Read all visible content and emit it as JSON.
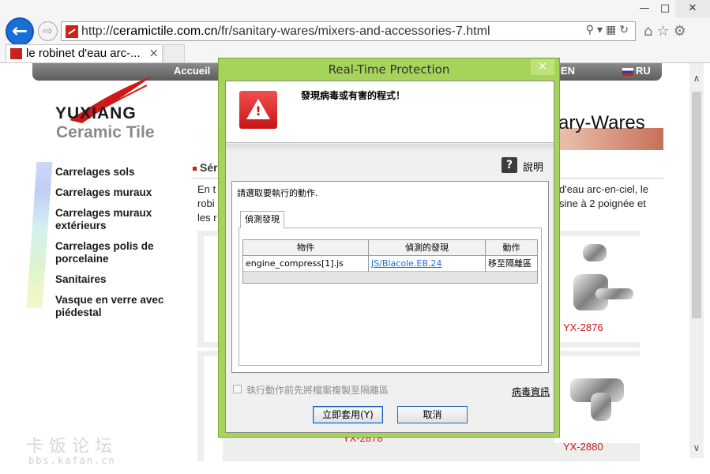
{
  "browser": {
    "address_url_prefix": "http://",
    "address_url_domain": "ceramictile.com.cn",
    "address_url_path": "/fr/sanitary-wares/mixers-and-accessories-7.html",
    "tab_title": "le robinet d'eau arc-...",
    "back_icon": "back-arrow-icon",
    "forward_icon": "forward-arrow-icon"
  },
  "site": {
    "nav": {
      "home": "Accueil",
      "lang_en": "EN",
      "lang_ru": "RU"
    },
    "logo_name": "YUXIANG",
    "logo_sub": "Ceramic Tile",
    "heading_fragment": "ary-Wares",
    "section_title_fragment": "Sér",
    "intro_left": [
      "En t",
      "robi",
      "les r"
    ],
    "intro_right": [
      "d'eau arc-en-ciel, le",
      "sine à 2 poignée et"
    ],
    "menu": [
      "Carrelages sols",
      "Carrelages muraux",
      "Carrelages muraux extérieurs",
      "Carrelages polis de porcelaine",
      "Sanitaires",
      "Vasque en verre avec piédestal"
    ],
    "products": {
      "row1_code": "YX-2876",
      "row2_code_partial": "YX-2878",
      "row2_code": "YX-2880"
    },
    "watermark": "卡饭论坛",
    "watermark_sub": "bbs.kafan.cn"
  },
  "dialog": {
    "title": "Real-Time Protection",
    "close_glyph": "×",
    "alert_text": "發現病毒或有害的程式！",
    "help_label": "說明",
    "group_label": "請選取要執行的動作.",
    "tab_label": "偵測發現",
    "columns": [
      "物件",
      "偵測的發現",
      "動作"
    ],
    "rows": [
      {
        "object": "engine_compress[1].js",
        "detection": "JS/Blacole.EB.24",
        "action": "移至隔離區"
      }
    ],
    "copy_checkbox_label": "執行動作前先將檔案複製至隔離區",
    "virus_info_link": "病毒資訊",
    "apply_button": "立即套用(Y)",
    "cancel_button": "取消"
  }
}
